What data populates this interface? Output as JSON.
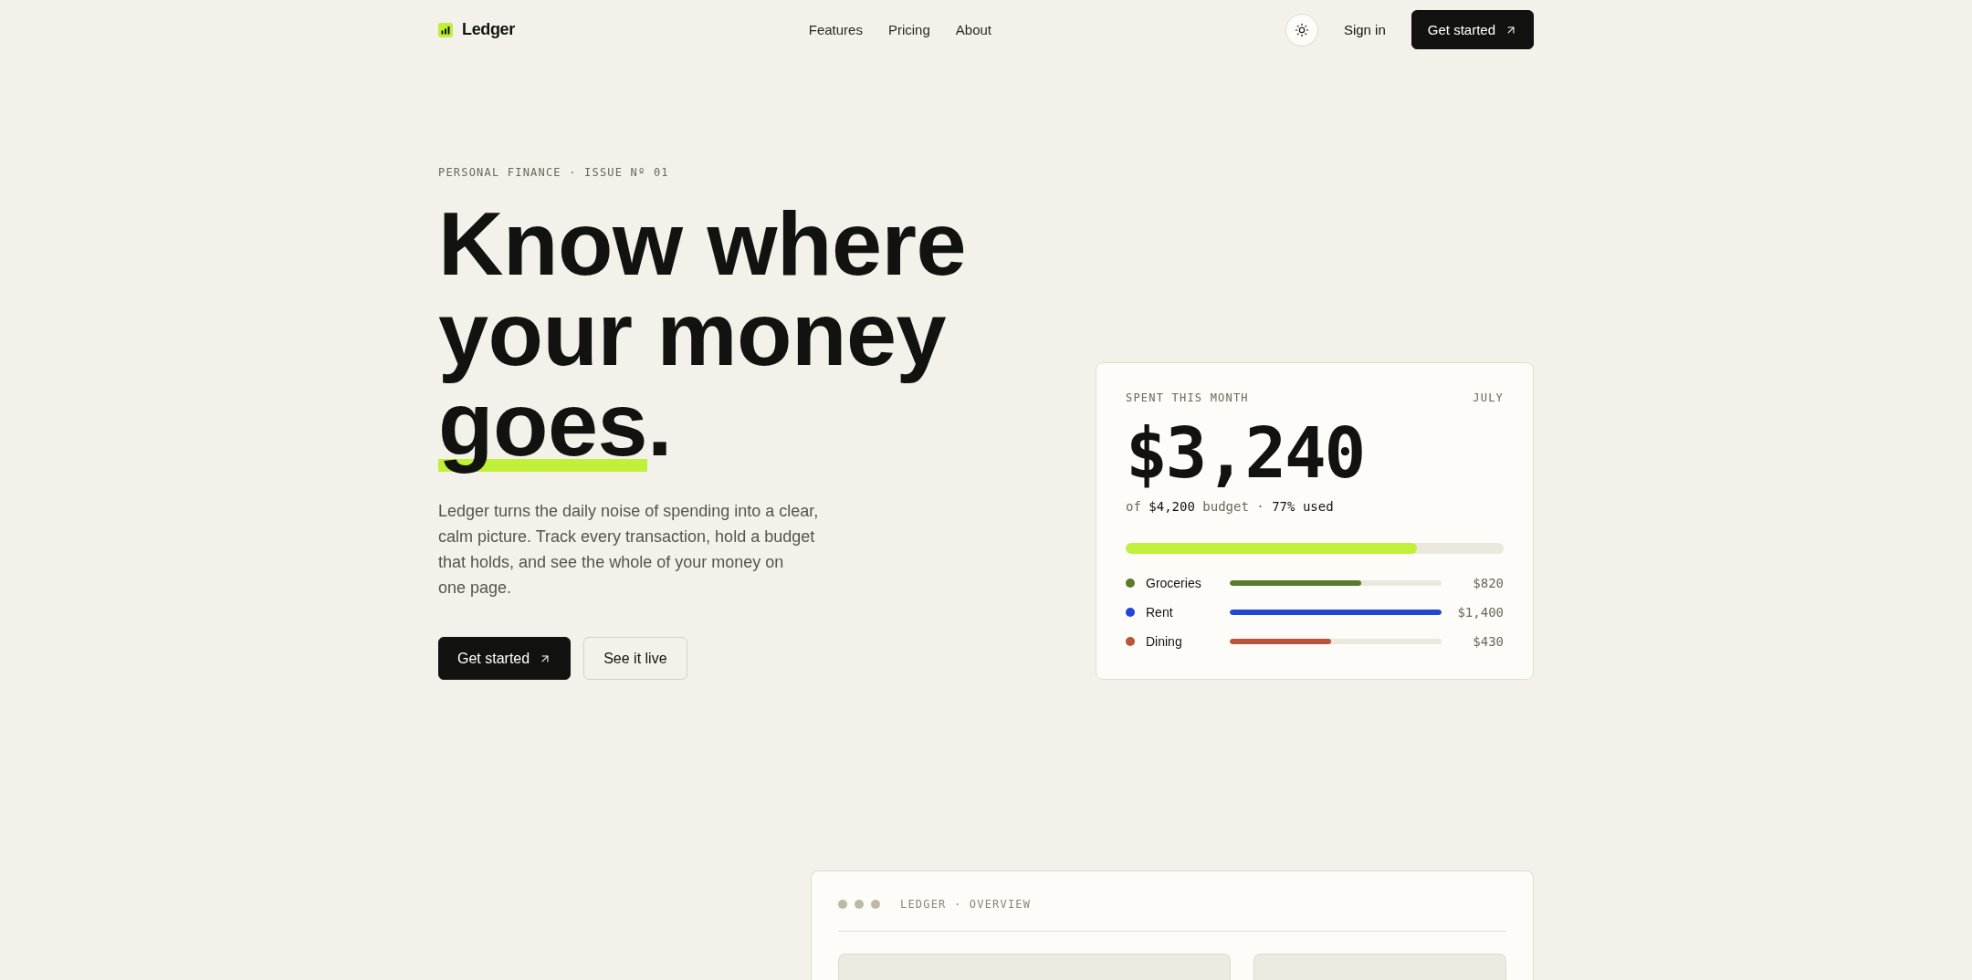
{
  "nav": {
    "logo": "Ledger",
    "links": [
      "Features",
      "Pricing",
      "About"
    ],
    "sign_in": "Sign in",
    "cta": "Get started"
  },
  "hero": {
    "eyebrow": "PERSONAL FINANCE · ISSUE Nº 01",
    "headline": {
      "lines": [
        "Know where",
        "your money"
      ],
      "highlight": "goes",
      "end": "."
    },
    "body": "Ledger turns the daily noise of spending into a clear, calm picture. Track every transaction, hold a budget that holds, and see the whole of your money on one page.",
    "buttons": [
      {
        "label": "Get started",
        "kind": "primary"
      },
      {
        "label": "See it live",
        "kind": "secondary"
      }
    ]
  },
  "spend_card": {
    "label": "SPENT THIS MONTH",
    "month": "JULY",
    "amount": "$3,240",
    "summary": "of **$4,200** budget · **77% used**",
    "budget": {
      "level": 0.77
    },
    "categories": [
      {
        "name": "Groceries",
        "color": "#5b7a2a",
        "level": 0.62,
        "amount": "$820"
      },
      {
        "name": "Rent",
        "color": "#2446d8",
        "level": 1,
        "amount": "$1,400"
      },
      {
        "name": "Dining",
        "color": "#b9553a",
        "level": 0.48,
        "amount": "$430"
      }
    ]
  },
  "preview": {
    "title": "LEDGER · OVERVIEW"
  }
}
